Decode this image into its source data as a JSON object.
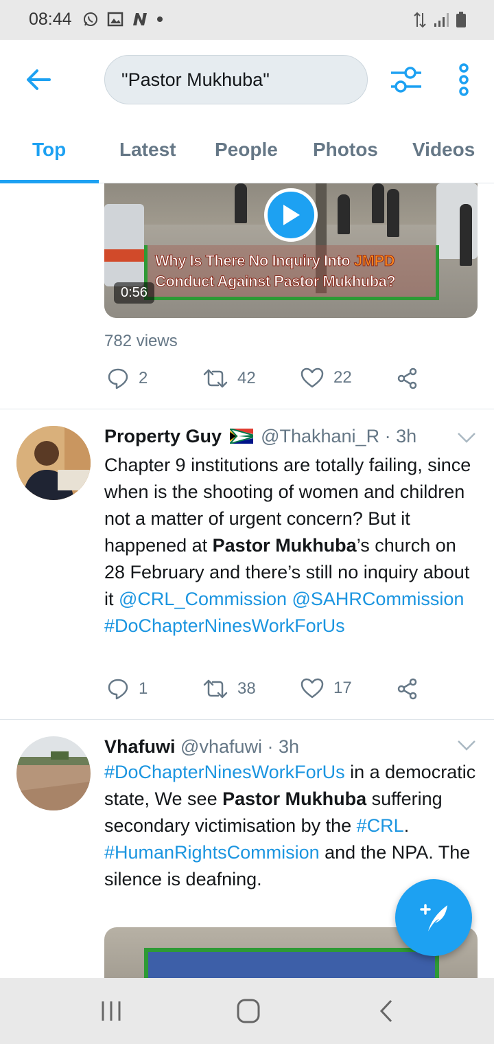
{
  "status_bar": {
    "time": "08:44",
    "notification_icons": [
      "whatsapp-icon",
      "gallery-icon",
      "n-app-icon",
      "dot-icon"
    ],
    "system_icons": [
      "data-arrows-icon",
      "signal-icon",
      "battery-icon"
    ]
  },
  "app_bar": {
    "search_query": "\"Pastor Mukhuba\"",
    "icons": [
      "back-arrow-icon",
      "filter-icon",
      "more-vertical-icon"
    ]
  },
  "tabs": [
    {
      "label": "Top",
      "active": true
    },
    {
      "label": "Latest",
      "active": false
    },
    {
      "label": "People",
      "active": false
    },
    {
      "label": "Photos",
      "active": false
    },
    {
      "label": "Videos",
      "active": false
    }
  ],
  "video_tweet": {
    "video_title_line1a": "Why Is There No Inquiry Into ",
    "video_title_line1b": "JMPD",
    "video_title_line2": "Conduct Against Pastor Mukhuba?",
    "duration": "0:56",
    "views": "782 views",
    "replies": "2",
    "retweets": "42",
    "likes": "22"
  },
  "tweets": [
    {
      "name": "Property Guy",
      "flag": "south-africa-flag-icon",
      "handle": "@Thakhani_R",
      "sep": " · ",
      "time": "3h",
      "text": {
        "p1": "Chapter 9 institutions are totally failing, since when is the shooting of women and children not a matter of urgent concern? But it happened at ",
        "b1": "Pastor Mukhuba",
        "p2": "’s church on 28 February and there’s still no inquiry about it ",
        "link1": "@CRL_Commission",
        "sp": " ",
        "link2": "@SAHRCommission",
        "link3": "#DoChapterNinesWorkForUs"
      },
      "replies": "1",
      "retweets": "38",
      "likes": "17"
    },
    {
      "name": "Vhafuwi",
      "handle": "@vhafuwi",
      "sep": " · ",
      "time": "3h",
      "text": {
        "link1": "#DoChapterNinesWorkForUs",
        "p1": " in a democratic state, We see ",
        "b1": "Pastor Mukhuba",
        "p2": " suffering secondary victimisation by the ",
        "link2": "#CRL",
        "p3": ". ",
        "link3": "#HumanRightsCommision",
        "p4": " and the NPA. The silence is deafning."
      }
    }
  ],
  "fab": {
    "icon": "compose-tweet-icon"
  },
  "nav_bar": {
    "icons": [
      "recents-icon",
      "home-icon",
      "back-icon"
    ]
  },
  "colors": {
    "accent": "#1da1f2",
    "muted": "#657786",
    "text": "#14171a",
    "link": "#1b95e0"
  }
}
